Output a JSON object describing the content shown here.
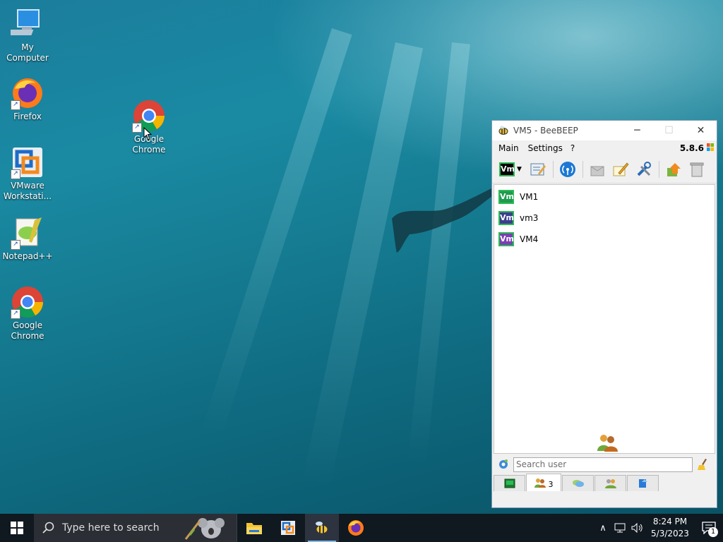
{
  "desktop": {
    "icons": [
      {
        "label": "My Computer",
        "icon": "computer-icon"
      },
      {
        "label": "Firefox",
        "icon": "firefox-icon"
      },
      {
        "label": "VMware Workstati...",
        "icon": "vmware-icon"
      },
      {
        "label": "Notepad++",
        "icon": "notepadpp-icon"
      },
      {
        "label": "Google Chrome",
        "icon": "chrome-icon"
      },
      {
        "label": "Google Chrome",
        "icon": "chrome-icon"
      }
    ]
  },
  "window": {
    "title": "VM5 - BeeBEEP",
    "minimize": "─",
    "maximize": "☐",
    "close": "✕",
    "menu": [
      "Main",
      "Settings",
      "?"
    ],
    "version": "5.8.6",
    "toolbar_status_badge": "Vm",
    "users": [
      {
        "badge": "Vm",
        "name": "VM1",
        "color": "#1f9a4e"
      },
      {
        "badge": "Vm",
        "name": "vm3",
        "color": "#3b3f8c"
      },
      {
        "badge": "Vm",
        "name": "VM4",
        "color": "#7b3fb3"
      }
    ],
    "search_placeholder": "Search user",
    "tabs": [
      {
        "icon": "home-icon",
        "label": ""
      },
      {
        "icon": "users-icon",
        "label": "3"
      },
      {
        "icon": "chat-icon",
        "label": ""
      },
      {
        "icon": "group-icon",
        "label": ""
      },
      {
        "icon": "file-share-icon",
        "label": ""
      }
    ]
  },
  "taskbar": {
    "search_placeholder": "Type here to search",
    "time": "8:24 PM",
    "date": "5/3/2023",
    "notification_count": "1"
  }
}
